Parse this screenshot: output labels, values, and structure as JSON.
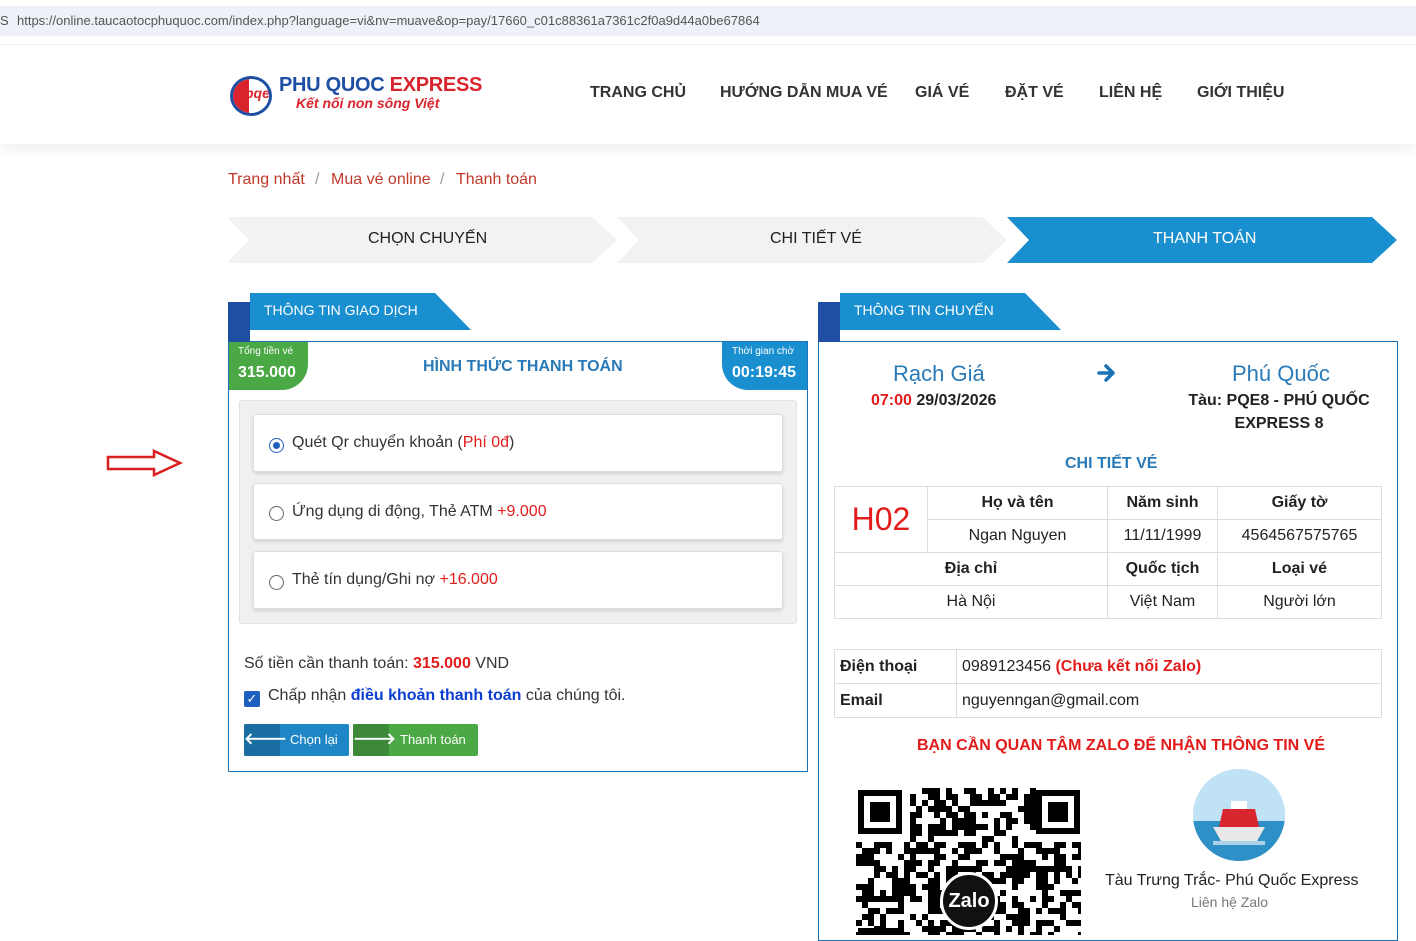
{
  "browser": {
    "edge_char": "S",
    "url": "https://online.taucaotocphuquoc.com/index.php?language=vi&nv=muave&op=pay/17660_c01c88361a7361c2f0a9d44a0be67864"
  },
  "header": {
    "logo_letters": "pqe",
    "logo_title_1": "PHU QUOC",
    "logo_title_2": "EXPRESS",
    "logo_subtitle": "Kết nối non sông Việt",
    "nav": [
      "TRANG CHỦ",
      "HƯỚNG DẪN MUA VÉ",
      "GIÁ VÉ",
      "ĐẶT VÉ",
      "LIÊN HỆ",
      "GIỚI THIỆU"
    ]
  },
  "breadcrumb": [
    "Trang nhất",
    "Mua vé online",
    "Thanh toán"
  ],
  "breadcrumb_sep": "/",
  "steps": [
    "CHỌN CHUYẾN",
    "CHI TIẾT VÉ",
    "THANH TOÁN"
  ],
  "steps_active_index": 2,
  "colors": {
    "accent": "#1a8fd0",
    "brand_blue": "#1f4fa3",
    "green": "#5cb85c",
    "red": "#e21b1b"
  },
  "transaction": {
    "tab_label": "THÔNG TIN GIAO DỊCH",
    "total_label": "Tổng tiền vé",
    "total_value": "315.000",
    "method_title": "HÌNH THỨC THANH TOÁN",
    "timer_label": "Thời gian chờ",
    "timer_value": "00:19:45",
    "options": [
      {
        "label": "Quét Qr chuyển khoản (",
        "fee": "Phí 0đ",
        "suffix": ")",
        "selected": true
      },
      {
        "label": "Ứng dụng di động, Thẻ ATM ",
        "fee": "+9.000",
        "suffix": "",
        "selected": false
      },
      {
        "label": "Thẻ tín dụng/Ghi nợ ",
        "fee": "+16.000",
        "suffix": "",
        "selected": false
      }
    ],
    "amount_label": "Số tiền cần thanh toán: ",
    "amount_value": "315.000",
    "amount_currency": " VND",
    "accept_prefix": "Chấp nhận ",
    "accept_link": "điều khoản thanh toán",
    "accept_suffix": " của chúng tôi.",
    "accept_checked": true,
    "back_button": "Chọn lại",
    "pay_button": "Thanh toán"
  },
  "trip": {
    "tab_label": "THÔNG TIN CHUYẾN",
    "from_city": "Rạch Giá",
    "depart_time": "07:00",
    "depart_date": " 29/03/2026",
    "to_city": "Phú Quốc",
    "ship_line1": "Tàu: PQE8 - PHÚ QUỐC",
    "ship_line2": "EXPRESS 8",
    "ticket_title": "CHI TIẾT VÉ",
    "seat": "H02",
    "headers1": [
      "Họ và tên",
      "Năm sinh",
      "Giấy tờ"
    ],
    "values1": [
      "Ngan Nguyen",
      "11/11/1999",
      "4564567575765"
    ],
    "headers2": [
      "Địa chỉ",
      "Quốc tịch",
      "Loại vé"
    ],
    "values2": [
      "Hà Nội",
      "Việt Nam",
      "Người lớn"
    ],
    "phone_label": "Điện thoại",
    "phone_value": "0989123456 ",
    "phone_note": "(Chưa kết nối Zalo)",
    "email_label": "Email",
    "email_value": "nguyenngan@gmail.com",
    "zalo_notice": "BẠN CẦN QUAN TÂM ZALO ĐỂ NHẬN THÔNG TIN VÉ",
    "zalo_logo": "Zalo",
    "zalo_name": "Tàu Trưng Trắc- Phú Quốc Express",
    "zalo_contact": "Liên hệ Zalo"
  }
}
